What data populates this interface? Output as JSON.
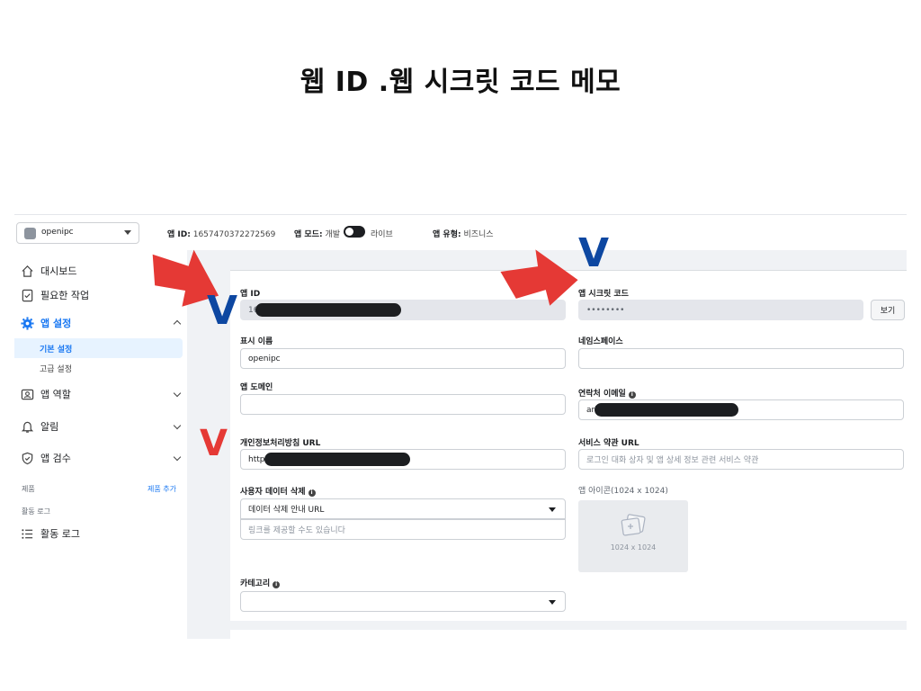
{
  "slide": {
    "title": "웹 ID .웹 시크릿 코드 메모"
  },
  "topbar": {
    "app_name": "openipc",
    "app_id_label": "앱 ID:",
    "app_id_value": "1657470372272569",
    "mode_label": "앱 모드:",
    "mode_dev": "개발",
    "mode_live": "라이브",
    "type_label": "앱 유형:",
    "type_value": "비즈니스"
  },
  "sidebar": {
    "dashboard": "대시보드",
    "required": "필요한 작업",
    "app_settings": "앱 설정",
    "basic_settings": "기본 설정",
    "advanced_settings": "고급 설정",
    "app_roles": "앱 역할",
    "alerts": "알림",
    "app_review": "앱 검수",
    "products_label": "제품",
    "add_product": "제품 추가",
    "activity_section": "활동 로그",
    "activity_log": "활동 로그"
  },
  "form": {
    "app_id_label": "앱 ID",
    "app_id_value": "16",
    "app_secret_label": "앱 시크릿 코드",
    "app_secret_value": "••••••••",
    "view_button": "보기",
    "display_name_label": "표시 이름",
    "display_name_value": "openipc",
    "namespace_label": "네임스페이스",
    "app_domain_label": "앱 도메인",
    "contact_email_label": "연락처 이메일",
    "contact_email_value": "ari",
    "privacy_url_label": "개인정보처리방침 URL",
    "privacy_url_value": "https",
    "terms_url_label": "서비스 약관 URL",
    "terms_url_placeholder": "로그인 대화 상자 및 앱 상세 정보 관련 서비스 약관",
    "data_deletion_label": "사용자 데이터 삭제",
    "data_deletion_select": "데이터 삭제 안내 URL",
    "data_deletion_placeholder": "링크를 제공할 수도 있습니다",
    "app_icon_label": "앱 아이콘(1024 x 1024)",
    "app_icon_size": "1024 x 1024",
    "category_label": "카테고리"
  },
  "annotations": {
    "check_mark": "V",
    "check_colors": {
      "blue": "#0d47a1",
      "red": "#e53935"
    },
    "arrow_color": "#e53935"
  }
}
